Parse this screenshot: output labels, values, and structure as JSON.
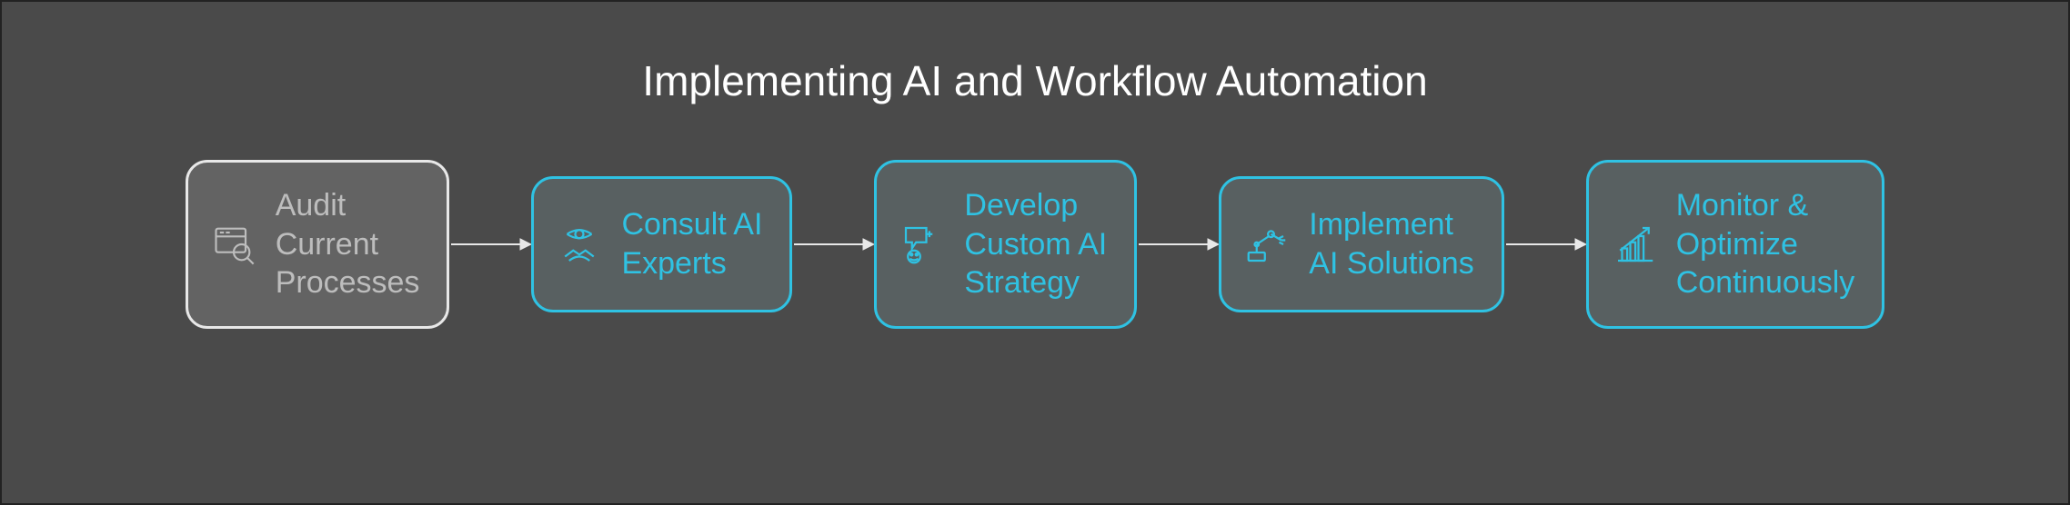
{
  "title": "Implementing AI and Workflow Automation",
  "steps": [
    {
      "label": "Audit\nCurrent\nProcesses",
      "icon": "audit-icon",
      "highlighted": false
    },
    {
      "label": "Consult AI\nExperts",
      "icon": "consult-icon",
      "highlighted": true
    },
    {
      "label": "Develop\nCustom AI\nStrategy",
      "icon": "strategy-icon",
      "highlighted": true
    },
    {
      "label": "Implement\nAI Solutions",
      "icon": "implement-icon",
      "highlighted": true
    },
    {
      "label": "Monitor &\nOptimize\nContinuously",
      "icon": "monitor-icon",
      "highlighted": true
    }
  ],
  "colors": {
    "background": "#4a4a4a",
    "accent": "#2fc2e3",
    "muted": "#bdbdbd",
    "arrow": "#e8e8e8"
  }
}
